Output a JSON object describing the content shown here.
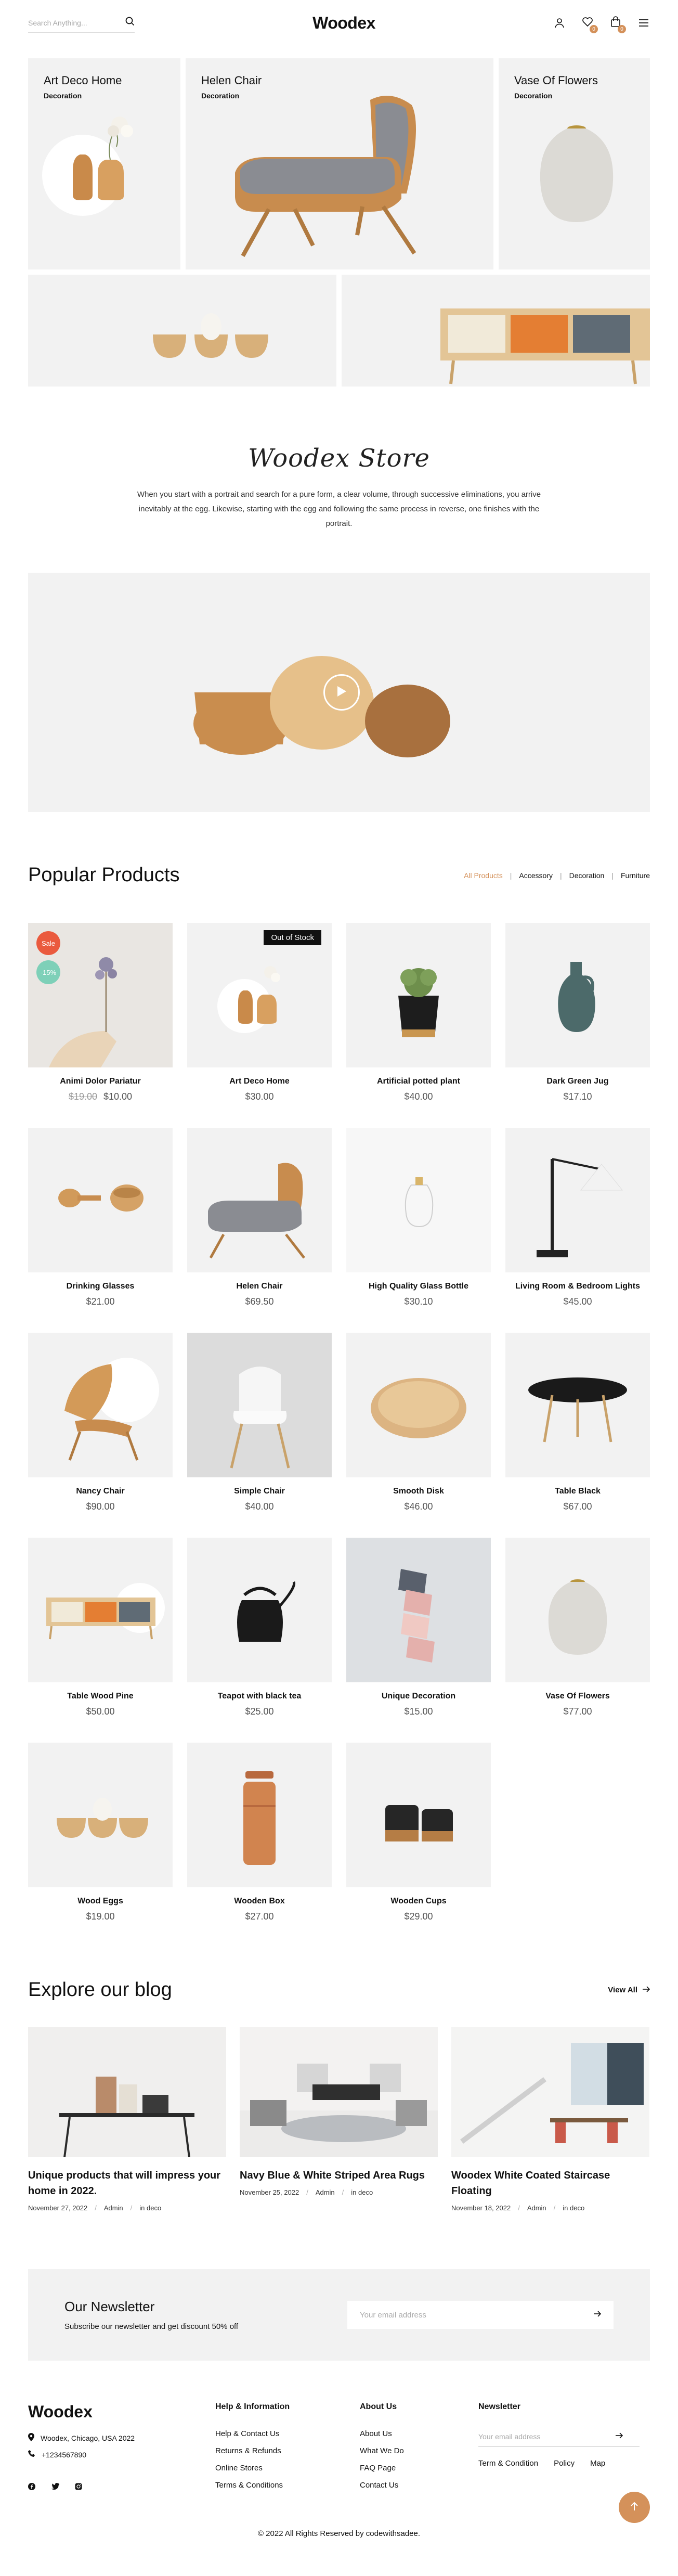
{
  "header": {
    "search_placeholder": "Search Anything...",
    "logo": "Woodex",
    "wishlist_count": "0",
    "cart_count": "0"
  },
  "hero": {
    "tiles": [
      {
        "title": "Art Deco Home",
        "subtitle": "Decoration"
      },
      {
        "title": "Helen Chair",
        "subtitle": "Decoration"
      },
      {
        "title": "Vase Of Flowers",
        "subtitle": "Decoration"
      }
    ]
  },
  "store": {
    "signature": "Woodex Store",
    "text": "When you start with a portrait and search for a pure form, a clear volume, through successive eliminations, you arrive inevitably at the egg. Likewise, starting with the egg and following the same process in reverse, one finishes with the portrait."
  },
  "popular": {
    "title": "Popular Products",
    "filters": [
      "All Products",
      "Accessory",
      "Decoration",
      "Furniture"
    ],
    "sale_label": "Sale",
    "pct_label": "-15%",
    "oos_label": "Out of Stock",
    "products": [
      {
        "name": "Animi Dolor Pariatur",
        "old_price": "$19.00",
        "price": "$10.00"
      },
      {
        "name": "Art Deco Home",
        "price": "$30.00"
      },
      {
        "name": "Artificial potted plant",
        "price": "$40.00"
      },
      {
        "name": "Dark Green Jug",
        "price": "$17.10"
      },
      {
        "name": "Drinking Glasses",
        "price": "$21.00"
      },
      {
        "name": "Helen Chair",
        "price": "$69.50"
      },
      {
        "name": "High Quality Glass Bottle",
        "price": "$30.10"
      },
      {
        "name": "Living Room & Bedroom Lights",
        "price": "$45.00"
      },
      {
        "name": "Nancy Chair",
        "price": "$90.00"
      },
      {
        "name": "Simple Chair",
        "price": "$40.00"
      },
      {
        "name": "Smooth Disk",
        "price": "$46.00"
      },
      {
        "name": "Table Black",
        "price": "$67.00"
      },
      {
        "name": "Table Wood Pine",
        "price": "$50.00"
      },
      {
        "name": "Teapot with black tea",
        "price": "$25.00"
      },
      {
        "name": "Unique Decoration",
        "price": "$15.00"
      },
      {
        "name": "Vase Of Flowers",
        "price": "$77.00"
      },
      {
        "name": "Wood Eggs",
        "price": "$19.00"
      },
      {
        "name": "Wooden Box",
        "price": "$27.00"
      },
      {
        "name": "Wooden Cups",
        "price": "$29.00"
      }
    ]
  },
  "blog": {
    "title": "Explore our blog",
    "view_all": "View All",
    "posts": [
      {
        "title": "Unique products that will impress your home in 2022.",
        "date": "November 27, 2022",
        "author": "Admin",
        "category": "in deco"
      },
      {
        "title": "Navy Blue & White Striped Area Rugs",
        "date": "November 25, 2022",
        "author": "Admin",
        "category": "in deco"
      },
      {
        "title": "Woodex White Coated Staircase Floating",
        "date": "November 18, 2022",
        "author": "Admin",
        "category": "in deco"
      }
    ]
  },
  "newsletter": {
    "title": "Our Newsletter",
    "subtitle": "Subscribe our newsletter and get discount 50% off",
    "placeholder": "Your email address"
  },
  "footer": {
    "logo": "Woodex",
    "address": "Woodex, Chicago, USA 2022",
    "phone": "+1234567890",
    "help_title": "Help & Information",
    "help_links": [
      "Help & Contact Us",
      "Returns & Refunds",
      "Online Stores",
      "Terms & Conditions"
    ],
    "about_title": "About Us",
    "about_links": [
      "About Us",
      "What We Do",
      "FAQ Page",
      "Contact Us"
    ],
    "newsletter_title": "Newsletter",
    "newsletter_placeholder": "Your email address",
    "bottom_links": [
      "Term & Condition",
      "Policy",
      "Map"
    ],
    "copyright": "© 2022 All Rights Reserved by codewithsadee."
  }
}
